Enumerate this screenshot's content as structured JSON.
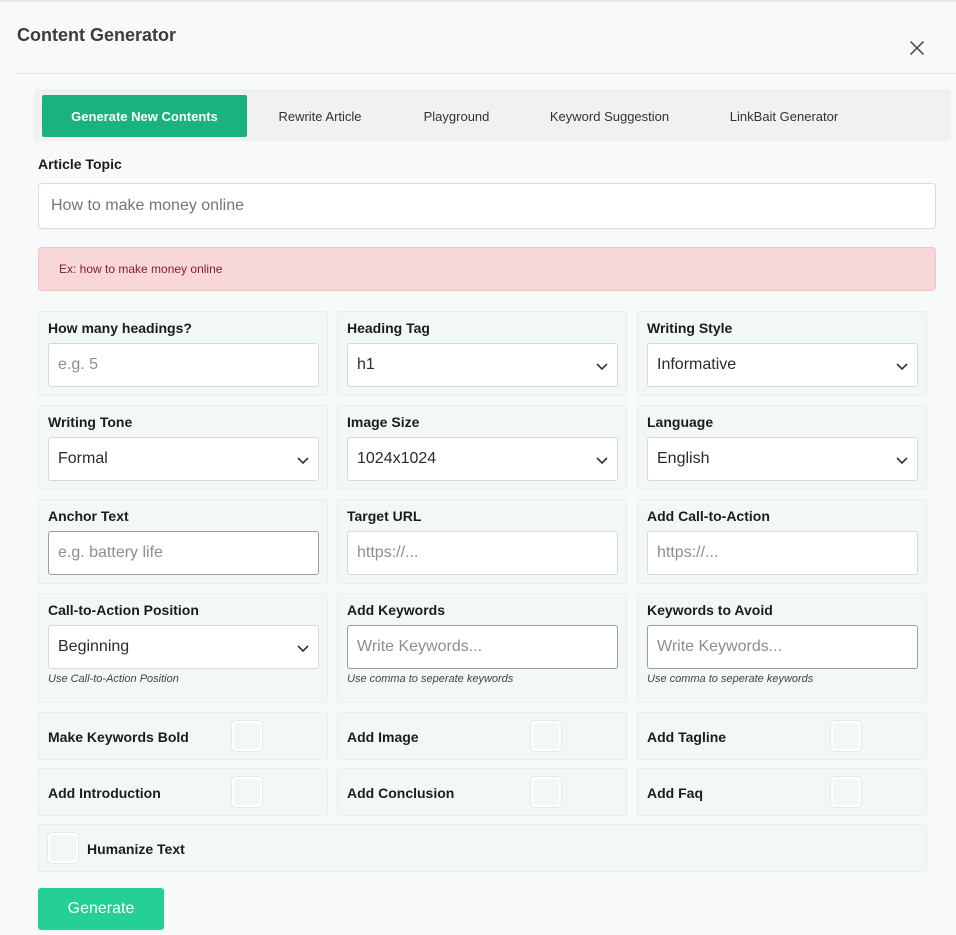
{
  "modal": {
    "title": "Content Generator"
  },
  "tabs": [
    {
      "label": "Generate New Contents",
      "active": true
    },
    {
      "label": "Rewrite Article",
      "active": false
    },
    {
      "label": "Playground",
      "active": false
    },
    {
      "label": "Keyword Suggestion",
      "active": false
    },
    {
      "label": "LinkBait Generator",
      "active": false
    }
  ],
  "article_topic": {
    "label": "Article Topic",
    "placeholder": "How to make money online",
    "hint": "Ex: how to make money online"
  },
  "fields": {
    "headings": {
      "label": "How many headings?",
      "placeholder": "e.g. 5"
    },
    "heading_tag": {
      "label": "Heading Tag",
      "value": "h1"
    },
    "writing_style": {
      "label": "Writing Style",
      "value": "Informative"
    },
    "writing_tone": {
      "label": "Writing Tone",
      "value": "Formal"
    },
    "image_size": {
      "label": "Image Size",
      "value": "1024x1024"
    },
    "language": {
      "label": "Language",
      "value": "English"
    },
    "anchor_text": {
      "label": "Anchor Text",
      "placeholder": "e.g. battery life"
    },
    "target_url": {
      "label": "Target URL",
      "placeholder": "https://..."
    },
    "cta": {
      "label": "Add Call-to-Action",
      "placeholder": "https://..."
    },
    "cta_position": {
      "label": "Call-to-Action Position",
      "value": "Beginning",
      "hint": "Use Call-to-Action Position"
    },
    "add_keywords": {
      "label": "Add Keywords",
      "placeholder": "Write Keywords...",
      "hint": "Use comma to seperate keywords"
    },
    "avoid_keywords": {
      "label": "Keywords to Avoid",
      "placeholder": "Write Keywords...",
      "hint": "Use comma to seperate keywords"
    }
  },
  "checkboxes": {
    "bold": {
      "label": "Make Keywords Bold",
      "checked": false
    },
    "image": {
      "label": "Add Image",
      "checked": false
    },
    "tagline": {
      "label": "Add Tagline",
      "checked": false
    },
    "introduction": {
      "label": "Add Introduction",
      "checked": false
    },
    "conclusion": {
      "label": "Add Conclusion",
      "checked": false
    },
    "faq": {
      "label": "Add Faq",
      "checked": false
    },
    "humanize": {
      "label": "Humanize Text",
      "checked": false
    }
  },
  "generate_button": {
    "label": "Generate"
  },
  "colors": {
    "accent": "#1ab27f",
    "button": "#25d096",
    "alert_bg": "#f8d7da",
    "alert_text": "#842029"
  },
  "icons": {
    "close": "close-icon",
    "chevron": "chevron-down-icon"
  }
}
